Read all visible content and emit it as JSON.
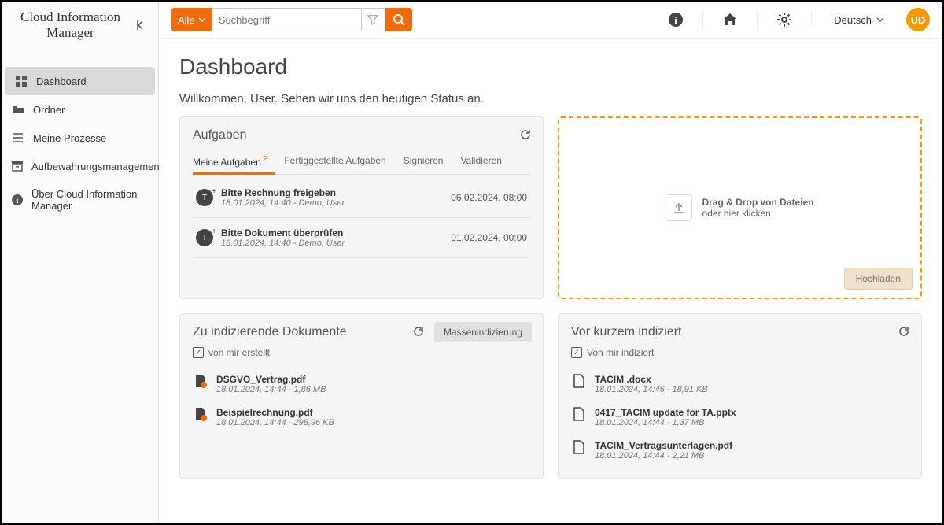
{
  "brand": "Cloud Information\nManager",
  "sidebar": {
    "items": [
      {
        "label": "Dashboard",
        "icon": "grid"
      },
      {
        "label": "Ordner",
        "icon": "folder"
      },
      {
        "label": "Meine Prozesse",
        "icon": "list"
      },
      {
        "label": "Aufbewahrungsmanagement",
        "icon": "archive"
      },
      {
        "label": "Über Cloud Information Manager",
        "icon": "info"
      }
    ]
  },
  "topbar": {
    "alle": "Alle",
    "search_placeholder": "Suchbegriff",
    "language": "Deutsch",
    "avatar": "UD"
  },
  "page": {
    "title": "Dashboard",
    "welcome": "Willkommen, User. Sehen wir uns den heutigen Status an."
  },
  "tasks_panel": {
    "title": "Aufgaben",
    "tabs": [
      {
        "label": "Meine Aufgaben",
        "badge": "2"
      },
      {
        "label": "Fertiggestellte Aufgaben"
      },
      {
        "label": "Signieren"
      },
      {
        "label": "Validieren"
      }
    ],
    "tasks": [
      {
        "title": "Bitte Rechnung freigeben",
        "meta": "18.01.2024, 14:40 - Demo, User",
        "date": "06.02.2024, 08:00"
      },
      {
        "title": "Bitte Dokument überprüfen",
        "meta": "18.01.2024, 14:40 - Demo, User",
        "date": "01.02.2024, 00:00"
      }
    ]
  },
  "upload_panel": {
    "line1": "Drag & Drop von Dateien",
    "line2": "oder hier klicken",
    "button": "Hochladen"
  },
  "to_index_panel": {
    "title": "Zu indizierende Dokumente",
    "mass_button": "Massenindizierung",
    "checkbox_label": "von mir erstellt",
    "docs": [
      {
        "title": "DSGVO_Vertrag.pdf",
        "meta": "18.01.2024, 14:44 - 1,86 MB"
      },
      {
        "title": "Beispielrechnung.pdf",
        "meta": "18.01.2024, 14:44 - 298,96 KB"
      }
    ]
  },
  "recent_panel": {
    "title": "Vor kurzem indiziert",
    "checkbox_label": "Von mir indiziert",
    "docs": [
      {
        "title": "TACIM .docx",
        "meta": "18.01.2024, 14:46 - 18,91 KB"
      },
      {
        "title": "0417_TACIM update for TA.pptx",
        "meta": "18.01.2024, 14:44 - 1,37 MB"
      },
      {
        "title": "TACIM_Vertragsunterlagen.pdf",
        "meta": "18.01.2024, 14:44 - 2,21 MB"
      }
    ]
  }
}
